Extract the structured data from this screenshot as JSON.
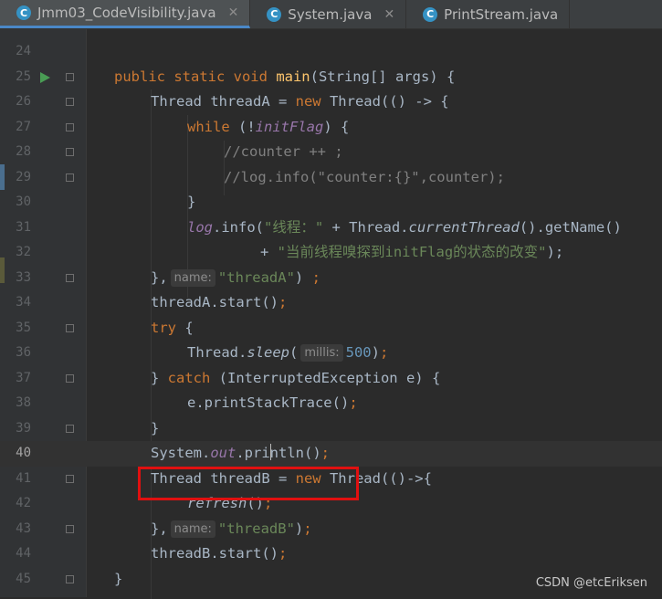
{
  "tabs": [
    {
      "label": "Jmm03_CodeVisibility.java",
      "icon": "class-c-icon",
      "active": true
    },
    {
      "label": "System.java",
      "icon": "class-c-icon",
      "active": false
    },
    {
      "label": "PrintStream.java",
      "icon": "class-c-icon",
      "active": false
    }
  ],
  "icon_glyph": "C",
  "close_glyph": "✕",
  "lines": [
    {
      "num": "24"
    },
    {
      "num": "25"
    },
    {
      "num": "26"
    },
    {
      "num": "27"
    },
    {
      "num": "28"
    },
    {
      "num": "29"
    },
    {
      "num": "30"
    },
    {
      "num": "31"
    },
    {
      "num": "32"
    },
    {
      "num": "33"
    },
    {
      "num": "34"
    },
    {
      "num": "35"
    },
    {
      "num": "36"
    },
    {
      "num": "37"
    },
    {
      "num": "38"
    },
    {
      "num": "39"
    },
    {
      "num": "40"
    },
    {
      "num": "41"
    },
    {
      "num": "42"
    },
    {
      "num": "43"
    },
    {
      "num": "44"
    },
    {
      "num": "45"
    }
  ],
  "code": {
    "l25": {
      "kw": "public static void ",
      "fn": "main",
      "rest": "(String[] args) {"
    },
    "l26": {
      "a": "Thread threadA = ",
      "kw": "new ",
      "b": "Thread(() -> {"
    },
    "l27": {
      "kw": "while ",
      "a": "(!",
      "fld": "initFlag",
      "b": ") {"
    },
    "l28": {
      "cmt": "//counter ++ ;"
    },
    "l29": {
      "cmt": "//log.info(\"counter:{}\",counter);"
    },
    "l30": {
      "a": "}"
    },
    "l31": {
      "fld": "log",
      "a": ".info(",
      "str": "\"线程：\"",
      "b": " + Thread.",
      "it": "currentThread",
      "c": "().getName()"
    },
    "l32": {
      "a": "+ ",
      "str": "\"当前线程嗅探到initFlag的状态的改变\"",
      "b": ");"
    },
    "l33": {
      "a": "},",
      "hint": "name:",
      "str": "\"threadA\"",
      "b": ") ",
      "kw": ";"
    },
    "l34": {
      "a": "threadA.start()",
      "kw": ";"
    },
    "l35": {
      "kw": "try ",
      "a": "{"
    },
    "l36": {
      "a": "Thread.",
      "it": "sleep",
      "b": "(",
      "hint": "millis:",
      "num": "500",
      "c": ")",
      "kw": ";"
    },
    "l37": {
      "a": "} ",
      "kw": "catch ",
      "b": "(InterruptedException e) {"
    },
    "l38": {
      "a": "e.printStackTrace()",
      "kw": ";"
    },
    "l39": {
      "a": "}"
    },
    "l40": {
      "a": "System.",
      "fld": "out",
      "b": ".pri",
      "c": "ntln()",
      "kw": ";"
    },
    "l41": {
      "a": "Thread threadB = ",
      "kw": "new ",
      "b": "Thread(()->{"
    },
    "l42": {
      "it": "refresh",
      "a": "()",
      "kw": ";"
    },
    "l43": {
      "a": "},",
      "hint": "name:",
      "str": "\"threadB\"",
      "b": ")",
      "kw": ";"
    },
    "l44": {
      "a": "threadB.start()",
      "kw": ";"
    },
    "l45": {
      "a": "}"
    }
  },
  "watermark": "CSDN @etcEriksen",
  "colors": {
    "keyword": "#cc7832",
    "method": "#ffc66d",
    "field": "#9876aa",
    "string": "#6a8759",
    "comment": "#808080",
    "number": "#6897bb",
    "highlight_box": "#e01010"
  }
}
